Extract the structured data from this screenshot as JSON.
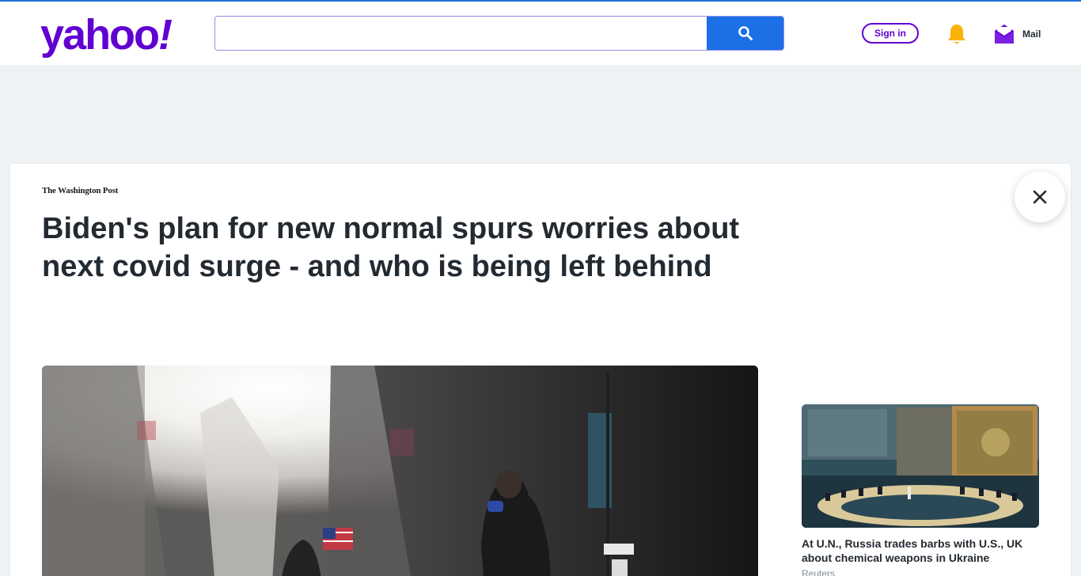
{
  "header": {
    "logo_text": "yahoo",
    "logo_mark": "!",
    "search_placeholder": "",
    "search_value": "",
    "signin_label": "Sign in",
    "mail_label": "Mail",
    "brand_color": "#6001d2",
    "search_button_color": "#1d6fe6"
  },
  "icons": {
    "search": "search-icon",
    "notifications": "bell-icon",
    "mail": "mail-icon",
    "close": "close-icon"
  },
  "article": {
    "publisher": "The Washington Post",
    "headline": "Biden's plan for new normal spurs worries about next covid surge - and who is being left behind"
  },
  "sidebar": {
    "story": {
      "title": "At U.N., Russia trades barbs with U.S., UK about chemical weapons in Ukraine",
      "source": "Reuters"
    }
  }
}
